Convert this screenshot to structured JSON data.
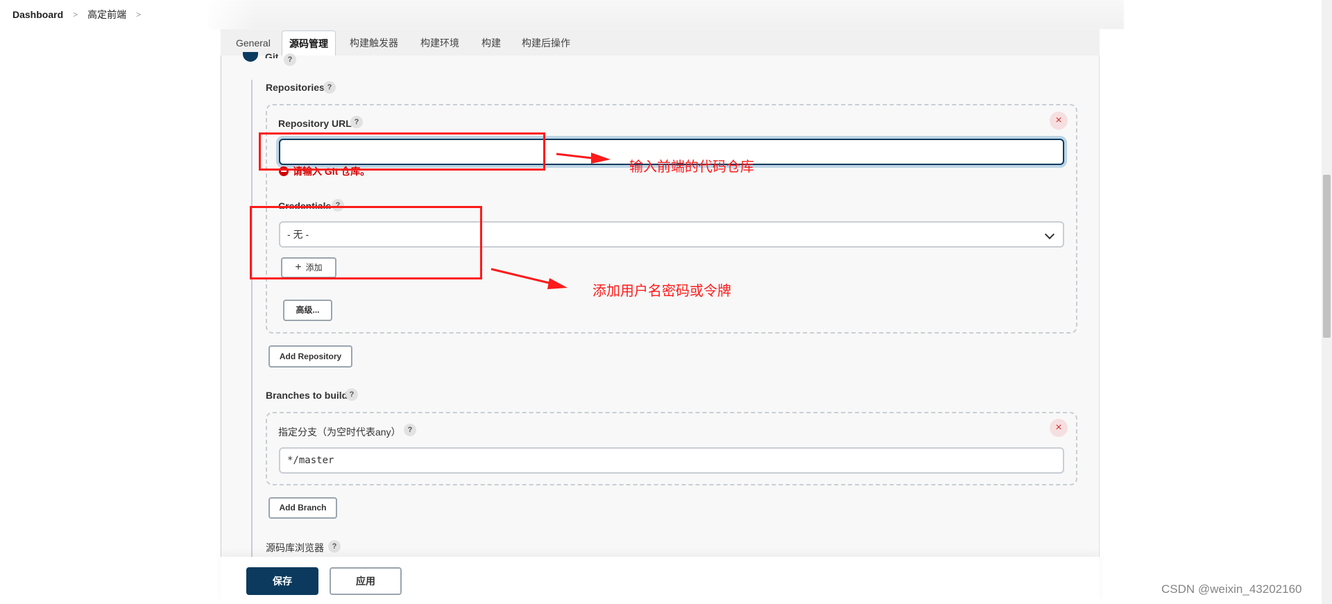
{
  "breadcrumb": {
    "items": [
      "Dashboard",
      "高定前端"
    ],
    "separator": ">"
  },
  "tabs": [
    {
      "label": "General",
      "active": false
    },
    {
      "label": "源码管理",
      "active": true
    },
    {
      "label": "构建触发器",
      "active": false
    },
    {
      "label": "构建环境",
      "active": false
    },
    {
      "label": "构建",
      "active": false
    },
    {
      "label": "构建后操作",
      "active": false
    }
  ],
  "scm": {
    "option_label": "Git",
    "help": "?",
    "repositories_label": "Repositories",
    "repository_url_label": "Repository URL",
    "repository_url_value": "",
    "repository_url_error": "请输入 Git 仓库。",
    "credentials_label": "Credentials",
    "credentials_selected": "- 无 -",
    "add_credentials_label": "添加",
    "advanced_label": "高级...",
    "add_repository_label": "Add Repository",
    "branches_label": "Branches to build",
    "branch_specifier_label": "指定分支（为空时代表any）",
    "branch_specifier_value": "*/master",
    "add_branch_label": "Add Branch",
    "repo_browser_label": "源码库浏览器",
    "delete_icon": "×"
  },
  "footer": {
    "save_label": "保存",
    "apply_label": "应用"
  },
  "annotations": {
    "repo_url_note": "输入前端的代码仓库",
    "credentials_note": "添加用户名密码或令牌",
    "color": "#ff1a1a"
  },
  "watermark": "CSDN @weixin_43202160",
  "colors": {
    "primary": "#0b3a5e",
    "error": "#d30000",
    "focus_ring": "#bcd4e4"
  }
}
